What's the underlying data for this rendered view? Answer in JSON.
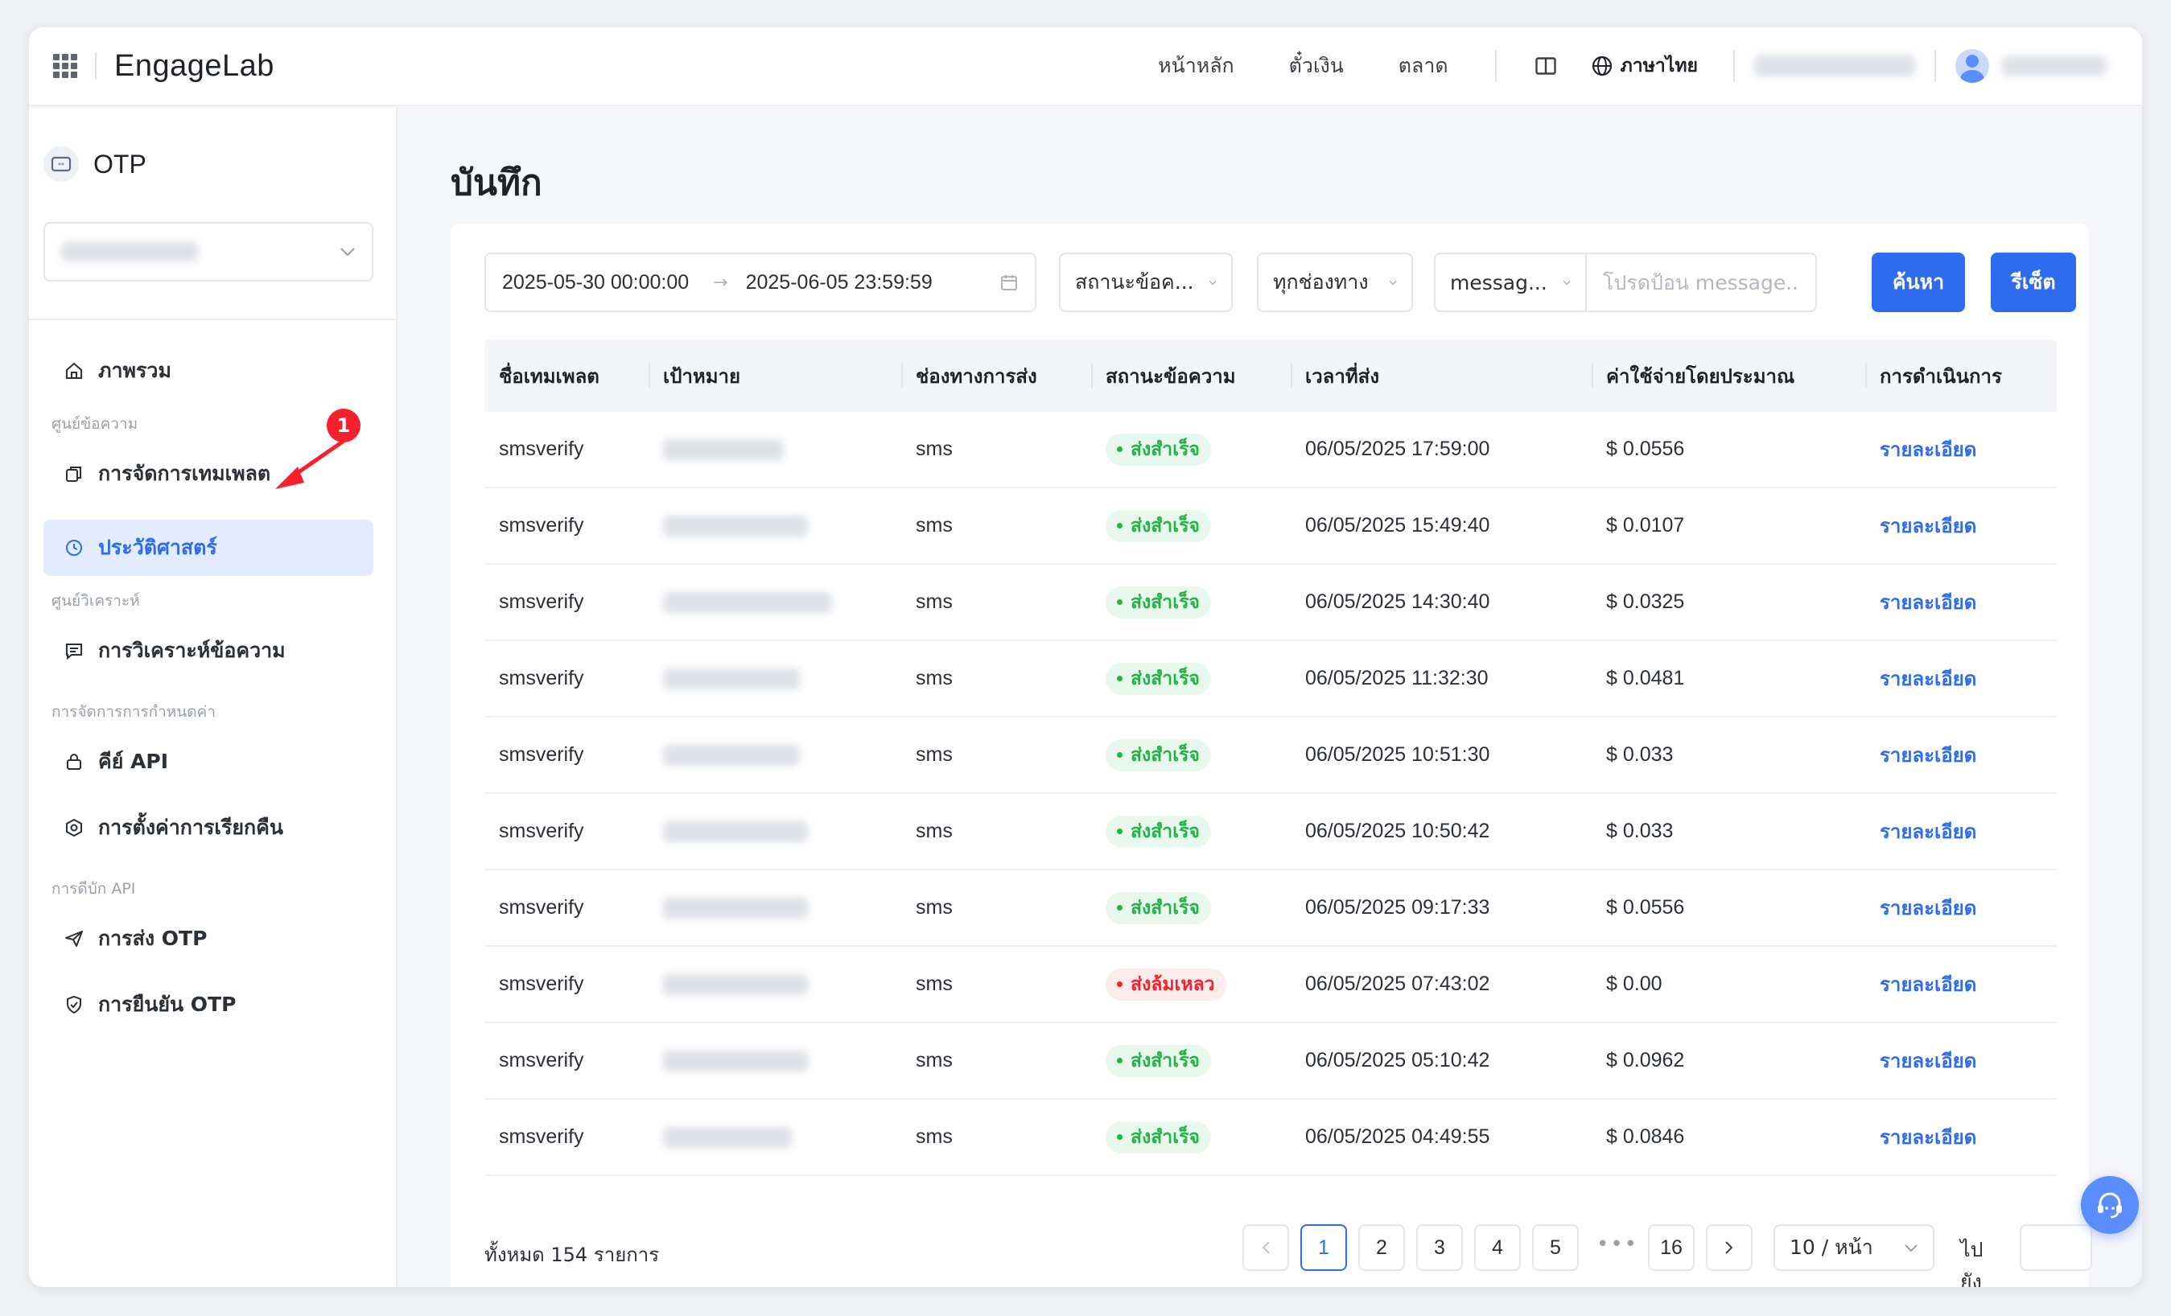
{
  "header": {
    "logo": "EngageLab",
    "nav": [
      "หน้าหลัก",
      "ตั๋วเงิน",
      "ตลาด"
    ],
    "language": "ภาษาไทย"
  },
  "sidebar": {
    "product": "OTP",
    "groups": [
      "ศูนย์ข้อความ",
      "ศูนย์วิเคราะห์",
      "การจัดการการกำหนดค่า",
      "การดีบัก API"
    ],
    "items": [
      {
        "label": "ภาพรวม",
        "icon": "home-icon"
      },
      {
        "label": "การจัดการเทมเพลต",
        "icon": "copy-icon"
      },
      {
        "label": "ประวัติศาสตร์",
        "icon": "history-icon"
      },
      {
        "label": "การวิเคราะห์ข้อความ",
        "icon": "message-icon"
      },
      {
        "label": "คีย์ API",
        "icon": "lock-icon"
      },
      {
        "label": "การตั้งค่าการเรียกคืน",
        "icon": "settings-icon"
      },
      {
        "label": "การส่ง OTP",
        "icon": "send-icon"
      },
      {
        "label": "การยืนยัน OTP",
        "icon": "shield-check-icon"
      }
    ],
    "active_item": "ประวัติศาสตร์",
    "annotation_number": "1"
  },
  "page": {
    "title": "บันทึก"
  },
  "filters": {
    "date_start": "2025-05-30 00:00:00",
    "date_end": "2025-06-05 23:59:59",
    "status_select": "สถานะข้อค...",
    "channel_select": "ทุกช่องทาง",
    "field_select": "messag...",
    "search_placeholder": "โปรดป้อน message...",
    "search_button": "ค้นหา",
    "reset_button": "รีเซ็ต"
  },
  "table": {
    "columns": [
      "ชื่อเทมเพลต",
      "เป้าหมาย",
      "ช่องทางการส่ง",
      "สถานะข้อความ",
      "เวลาที่ส่ง",
      "ค่าใช้จ่ายโดยประมาณ",
      "การดำเนินการ"
    ],
    "rows": [
      {
        "template": "smsverify",
        "channel": "sms",
        "status": "ส่งสำเร็จ",
        "time": "06/05/2025 17:59:00",
        "cost": "$ 0.0556",
        "action": "รายละเอียด"
      },
      {
        "template": "smsverify",
        "channel": "sms",
        "status": "ส่งสำเร็จ",
        "time": "06/05/2025 15:49:40",
        "cost": "$ 0.0107",
        "action": "รายละเอียด"
      },
      {
        "template": "smsverify",
        "channel": "sms",
        "status": "ส่งสำเร็จ",
        "time": "06/05/2025 14:30:40",
        "cost": "$ 0.0325",
        "action": "รายละเอียด"
      },
      {
        "template": "smsverify",
        "channel": "sms",
        "status": "ส่งสำเร็จ",
        "time": "06/05/2025 11:32:30",
        "cost": "$ 0.0481",
        "action": "รายละเอียด"
      },
      {
        "template": "smsverify",
        "channel": "sms",
        "status": "ส่งสำเร็จ",
        "time": "06/05/2025 10:51:30",
        "cost": "$ 0.033",
        "action": "รายละเอียด"
      },
      {
        "template": "smsverify",
        "channel": "sms",
        "status": "ส่งสำเร็จ",
        "time": "06/05/2025 10:50:42",
        "cost": "$ 0.033",
        "action": "รายละเอียด"
      },
      {
        "template": "smsverify",
        "channel": "sms",
        "status": "ส่งสำเร็จ",
        "time": "06/05/2025 09:17:33",
        "cost": "$ 0.0556",
        "action": "รายละเอียด"
      },
      {
        "template": "smsverify",
        "channel": "sms",
        "status": "ส่งล้มเหลว",
        "time": "06/05/2025 07:43:02",
        "cost": "$ 0.00",
        "action": "รายละเอียด"
      },
      {
        "template": "smsverify",
        "channel": "sms",
        "status": "ส่งสำเร็จ",
        "time": "06/05/2025 05:10:42",
        "cost": "$ 0.0962",
        "action": "รายละเอียด"
      },
      {
        "template": "smsverify",
        "channel": "sms",
        "status": "ส่งสำเร็จ",
        "time": "06/05/2025 04:49:55",
        "cost": "$ 0.0846",
        "action": "รายละเอียด"
      }
    ]
  },
  "pagination": {
    "total": "ทั้งหมด 154 รายการ",
    "pages": [
      "1",
      "2",
      "3",
      "4",
      "5",
      "16"
    ],
    "current": "1",
    "ellipsis": "•••",
    "page_size": "10 / หน้า",
    "goto_label": "ไปยัง"
  },
  "colors": {
    "accent": "#2f6bef",
    "success": "#24b14a",
    "danger": "#f5222d"
  }
}
